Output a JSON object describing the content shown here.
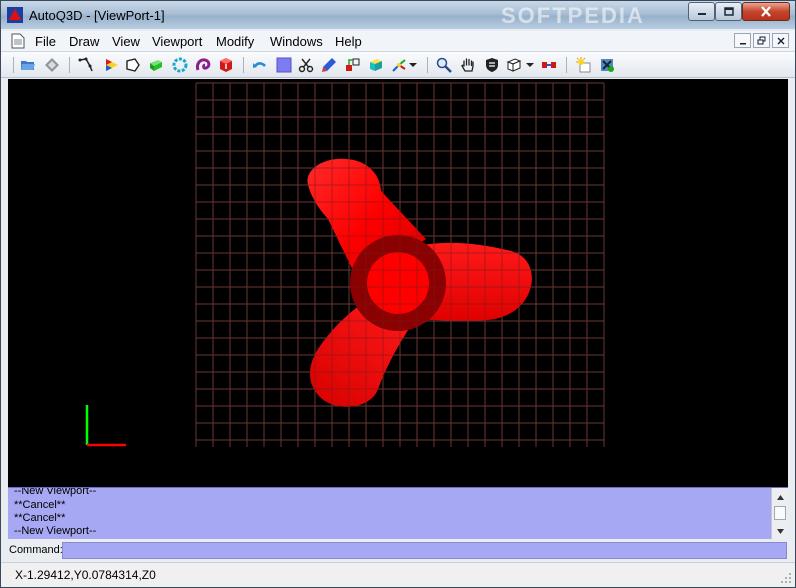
{
  "window": {
    "title": "AutoQ3D - [ViewPort-1]",
    "watermark": "SOFTPEDIA"
  },
  "menu": {
    "items": [
      "File",
      "Draw",
      "View",
      "Viewport",
      "Modify",
      "Windows",
      "Help"
    ]
  },
  "toolbar": {
    "icons": [
      "open-folder-icon",
      "eraser-icon",
      "polyline-icon",
      "color-icon",
      "tag-icon",
      "box-icon",
      "ring-icon",
      "torus-icon",
      "cube-icon",
      "undo-icon",
      "square-icon",
      "scissors-icon",
      "pen-icon",
      "align-icon",
      "cube-color-icon",
      "axis-icon",
      "dropdown-arrow-icon",
      "zoom-icon",
      "pan-hand-icon",
      "shield-icon",
      "view-cube-icon",
      "dropdown-arrow-icon",
      "dimension-icon",
      "light-icon",
      "settings-icon"
    ]
  },
  "log": {
    "lines": [
      "--New Viewport--",
      "**Cancel**",
      "**Cancel**",
      "--New Viewport--"
    ]
  },
  "command": {
    "label": "Command:",
    "value": ""
  },
  "status": {
    "coords": "X-1.29412,Y0.0784314,Z0"
  },
  "colors": {
    "viewport_bg": "#000000",
    "model_red": "#ff0000",
    "model_dark": "#8b0000",
    "log_bg": "#a7a8f4",
    "axis_x": "#ff0000",
    "axis_y": "#00ff00"
  }
}
